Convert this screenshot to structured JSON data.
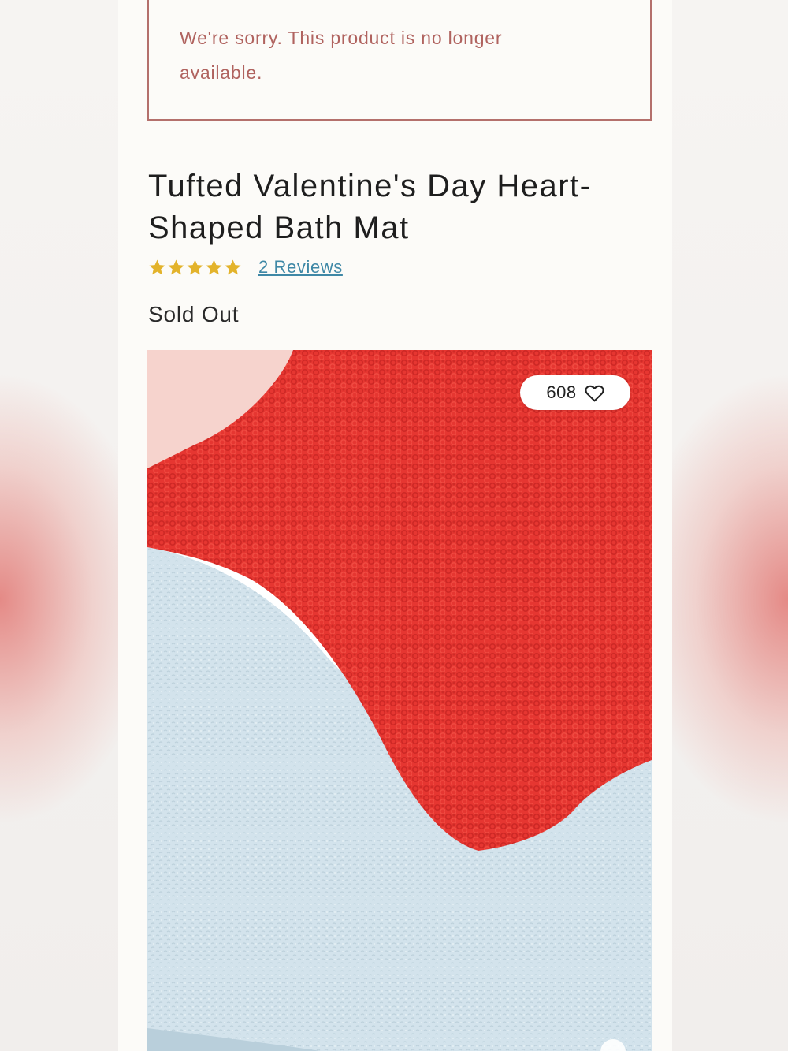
{
  "notice": {
    "message_line1": "We're sorry. This product is no longer",
    "message_line2": "available."
  },
  "product": {
    "title_line1": "Tufted Valentine's Day Heart-",
    "title_line2": "Shaped Bath Mat",
    "rating_stars": 5,
    "reviews_label": "2 Reviews",
    "stock_status": "Sold Out",
    "likes_count": "608"
  },
  "icons": {
    "star": "star-icon",
    "like": "heart-icon"
  },
  "colors": {
    "notice_border": "#b4706c",
    "notice_text": "#b0635f",
    "star": "#e3b32b",
    "link": "#3f88a6",
    "mat_red": "#e2302c",
    "mat_blue": "#cfe0ea",
    "mat_pink": "#f6d2cc"
  }
}
